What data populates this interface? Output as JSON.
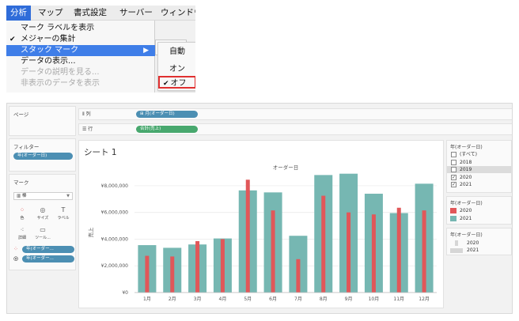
{
  "menu": {
    "bar": [
      "分析",
      "マップ",
      "書式設定",
      "サーバー",
      "ウィンドウ"
    ],
    "items": [
      {
        "label": "マーク ラベルを表示",
        "state": "normal"
      },
      {
        "label": "メジャーの集計",
        "state": "checked"
      },
      {
        "label": "スタック マーク",
        "state": "highlight",
        "arrow": "▶"
      },
      {
        "label": "データの表示...",
        "state": "normal"
      },
      {
        "label": "データの説明を見る...",
        "state": "disabled"
      },
      {
        "label": "非表示のデータを表示",
        "state": "disabled"
      }
    ],
    "submenu": [
      "自動",
      "オン",
      "オフ"
    ]
  },
  "left": {
    "pages_title": "ページ",
    "filters_title": "フィルター",
    "filter_pill": "年(オーダー日)",
    "marks_title": "マーク",
    "mark_type": "棒",
    "buttons": [
      "色",
      "サイズ",
      "ラベル",
      "詳細",
      "ツール..."
    ],
    "mark_fields": [
      "年(オーダー...",
      "年(オーダー..."
    ]
  },
  "shelves": {
    "columns_label": "列",
    "columns_pill": "月(オーダー日)",
    "rows_label": "行",
    "rows_pill": "合計(売上)"
  },
  "sheet": {
    "title": "シート 1"
  },
  "chart_data": {
    "type": "bar",
    "title": "",
    "header": "オーダー日",
    "ylabel": "売上",
    "categories": [
      "1月",
      "2月",
      "3月",
      "4月",
      "5月",
      "6月",
      "7月",
      "8月",
      "9月",
      "10月",
      "11月",
      "12月"
    ],
    "yticks": [
      "¥0",
      "¥2,000,000",
      "¥4,000,000",
      "¥6,000,000",
      "¥8,000,000"
    ],
    "ylim": [
      0,
      9000000
    ],
    "series": [
      {
        "name": "2020",
        "color": "#e15759",
        "values": [
          2750000,
          2700000,
          3850000,
          4000000,
          8450000,
          6150000,
          2500000,
          7250000,
          6000000,
          5850000,
          6350000,
          6150000
        ]
      },
      {
        "name": "2021",
        "color": "#76b7b2",
        "values": [
          3550000,
          3350000,
          3600000,
          4050000,
          7650000,
          7500000,
          4250000,
          8800000,
          8900000,
          7400000,
          5950000,
          8150000
        ]
      }
    ],
    "grid": true,
    "legend": "right"
  },
  "filter_panel": {
    "title": "年(オーダー日)",
    "items": [
      {
        "label": "(すべて)",
        "checked": false,
        "selected": false
      },
      {
        "label": "2018",
        "checked": false,
        "selected": false
      },
      {
        "label": "2019",
        "checked": false,
        "selected": true
      },
      {
        "label": "2020",
        "checked": true,
        "selected": false
      },
      {
        "label": "2021",
        "checked": true,
        "selected": false
      }
    ]
  },
  "color_legend": {
    "title": "年(オーダー日)",
    "items": [
      {
        "label": "2020",
        "color": "#e15759"
      },
      {
        "label": "2021",
        "color": "#76b7b2"
      }
    ]
  },
  "size_legend": {
    "title": "年(オーダー日)",
    "items": [
      "2020",
      "2021"
    ]
  }
}
